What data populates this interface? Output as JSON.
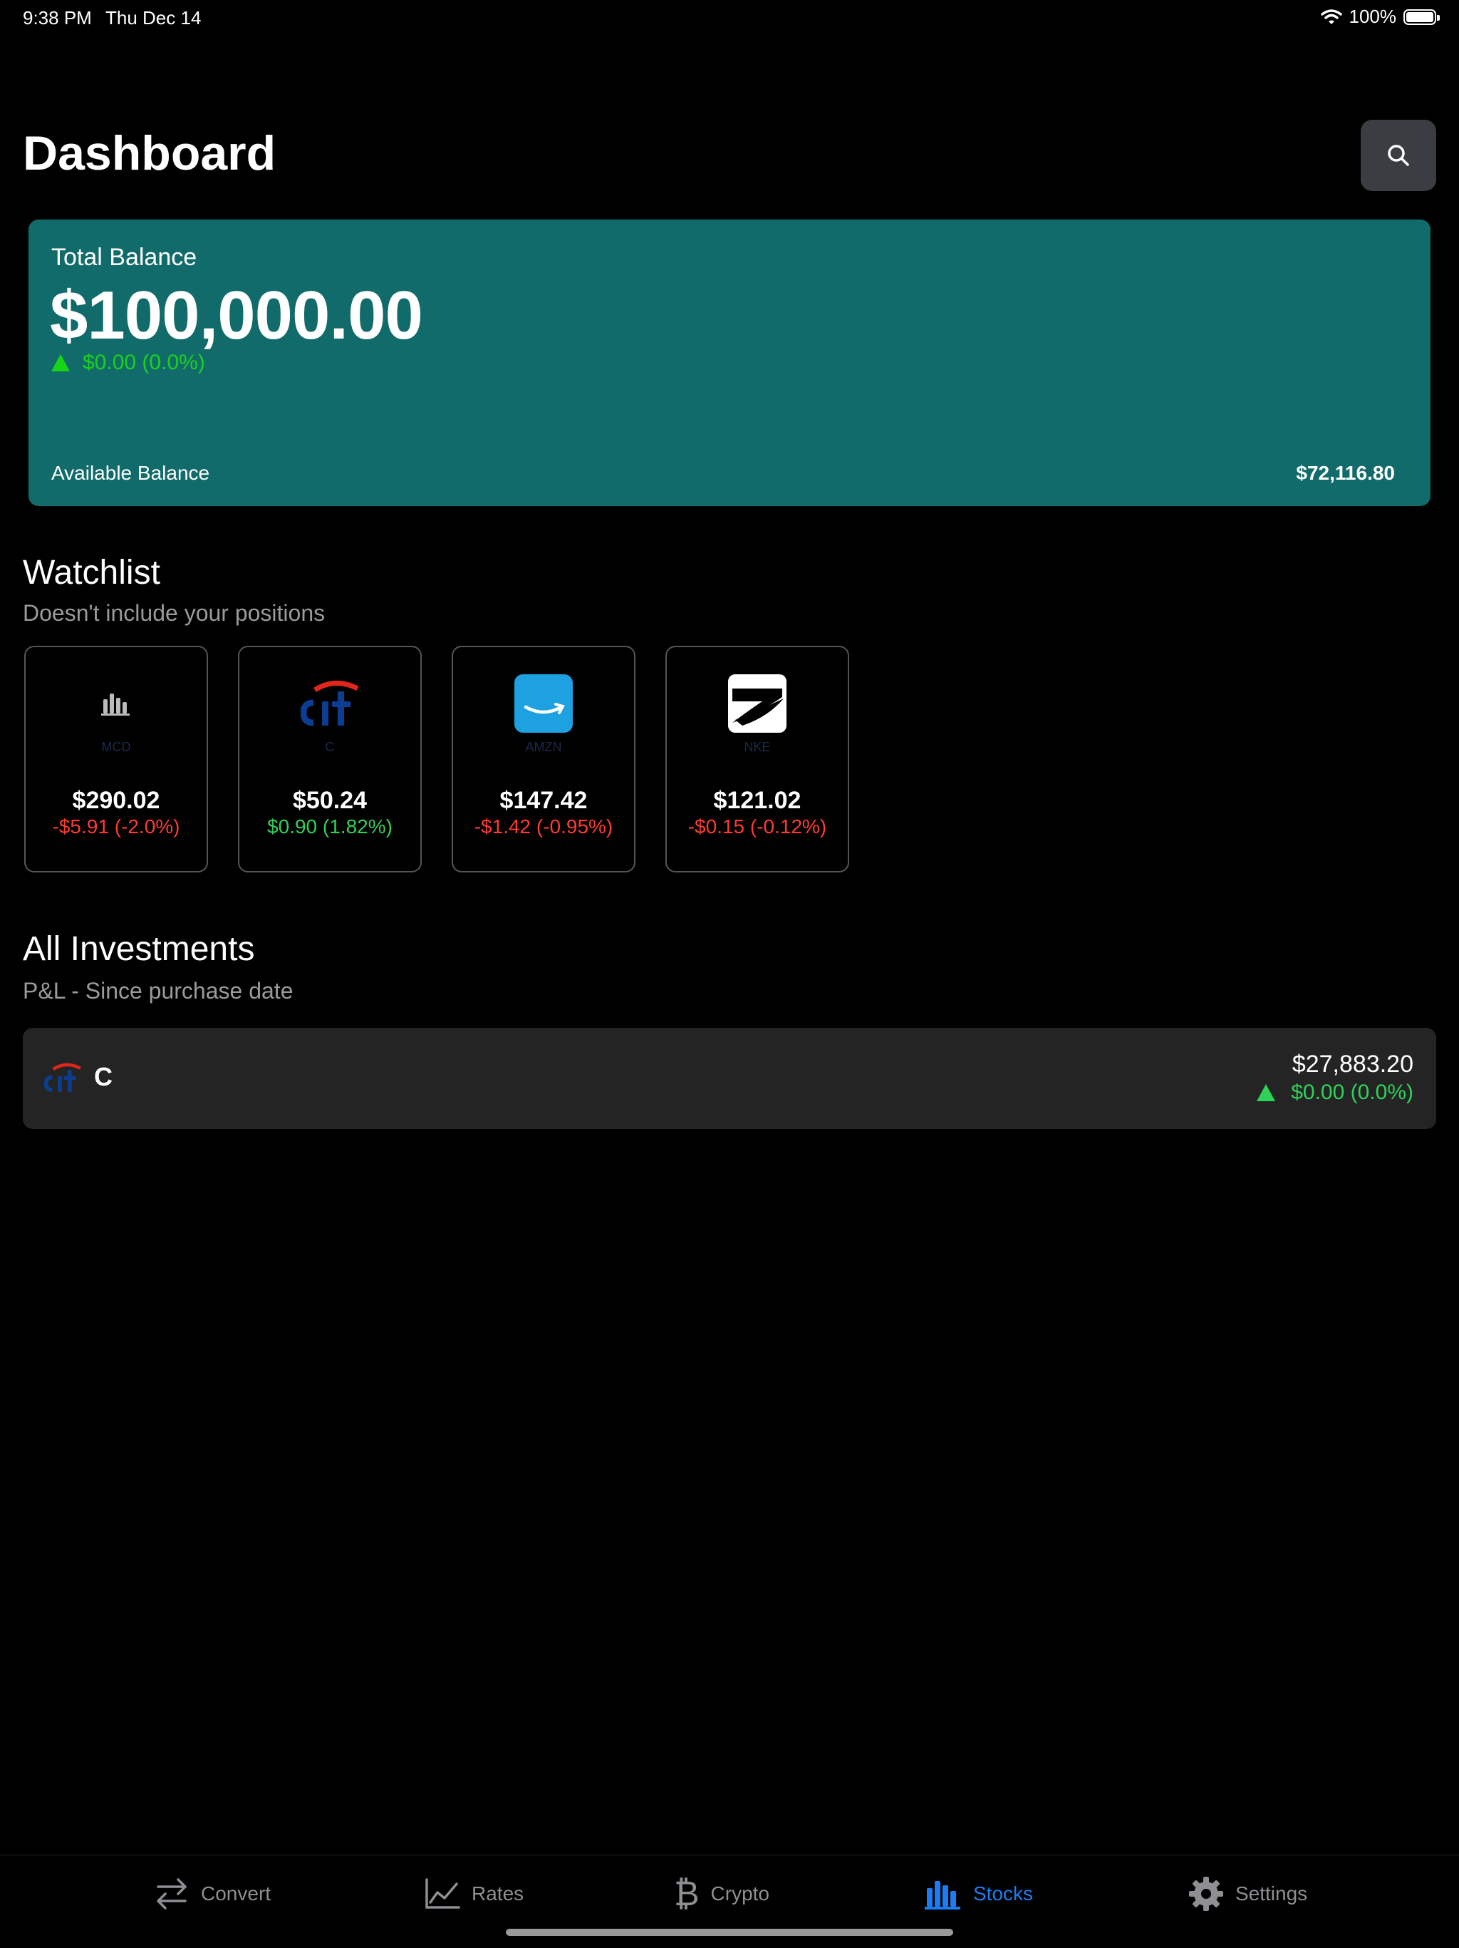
{
  "status_bar": {
    "time": "9:38 PM",
    "date": "Thu Dec 14",
    "battery": "100%"
  },
  "header": {
    "title": "Dashboard",
    "search_icon": "search-icon"
  },
  "balance": {
    "label": "Total Balance",
    "amount": "$100,000.00",
    "change": "$0.00 (0.0%)",
    "available_label": "Available Balance",
    "available_value": "$72,116.80",
    "card_color": "#126b6b",
    "up_color": "#1cd11c"
  },
  "watchlist": {
    "title": "Watchlist",
    "subtitle": "Doesn't include your positions",
    "items": [
      {
        "ticker": "MCD",
        "price": "$290.02",
        "change": "-$5.91 (-2.0%)",
        "direction": "down",
        "icon": "bar-chart-icon"
      },
      {
        "ticker": "C",
        "price": "$50.24",
        "change": "$0.90 (1.82%)",
        "direction": "up",
        "icon": "citi-logo-icon"
      },
      {
        "ticker": "AMZN",
        "price": "$147.42",
        "change": "-$1.42 (-0.95%)",
        "direction": "down",
        "icon": "amazon-logo-icon"
      },
      {
        "ticker": "NKE",
        "price": "$121.02",
        "change": "-$0.15 (-0.12%)",
        "direction": "down",
        "icon": "nike-logo-icon"
      }
    ]
  },
  "investments": {
    "title": "All Investments",
    "subtitle": "P&L - Since purchase date",
    "items": [
      {
        "ticker": "C",
        "value": "$27,883.20",
        "change": "$0.00 (0.0%)",
        "icon": "citi-logo-icon"
      }
    ]
  },
  "tabbar": {
    "items": [
      {
        "label": "Convert",
        "icon": "arrows-left-right-icon"
      },
      {
        "label": "Rates",
        "icon": "line-chart-icon"
      },
      {
        "label": "Crypto",
        "icon": "bitcoin-icon"
      },
      {
        "label": "Stocks",
        "icon": "bar-chart-icon",
        "active": true
      },
      {
        "label": "Settings",
        "icon": "gear-icon"
      }
    ],
    "active_color": "#1e7cf2"
  }
}
